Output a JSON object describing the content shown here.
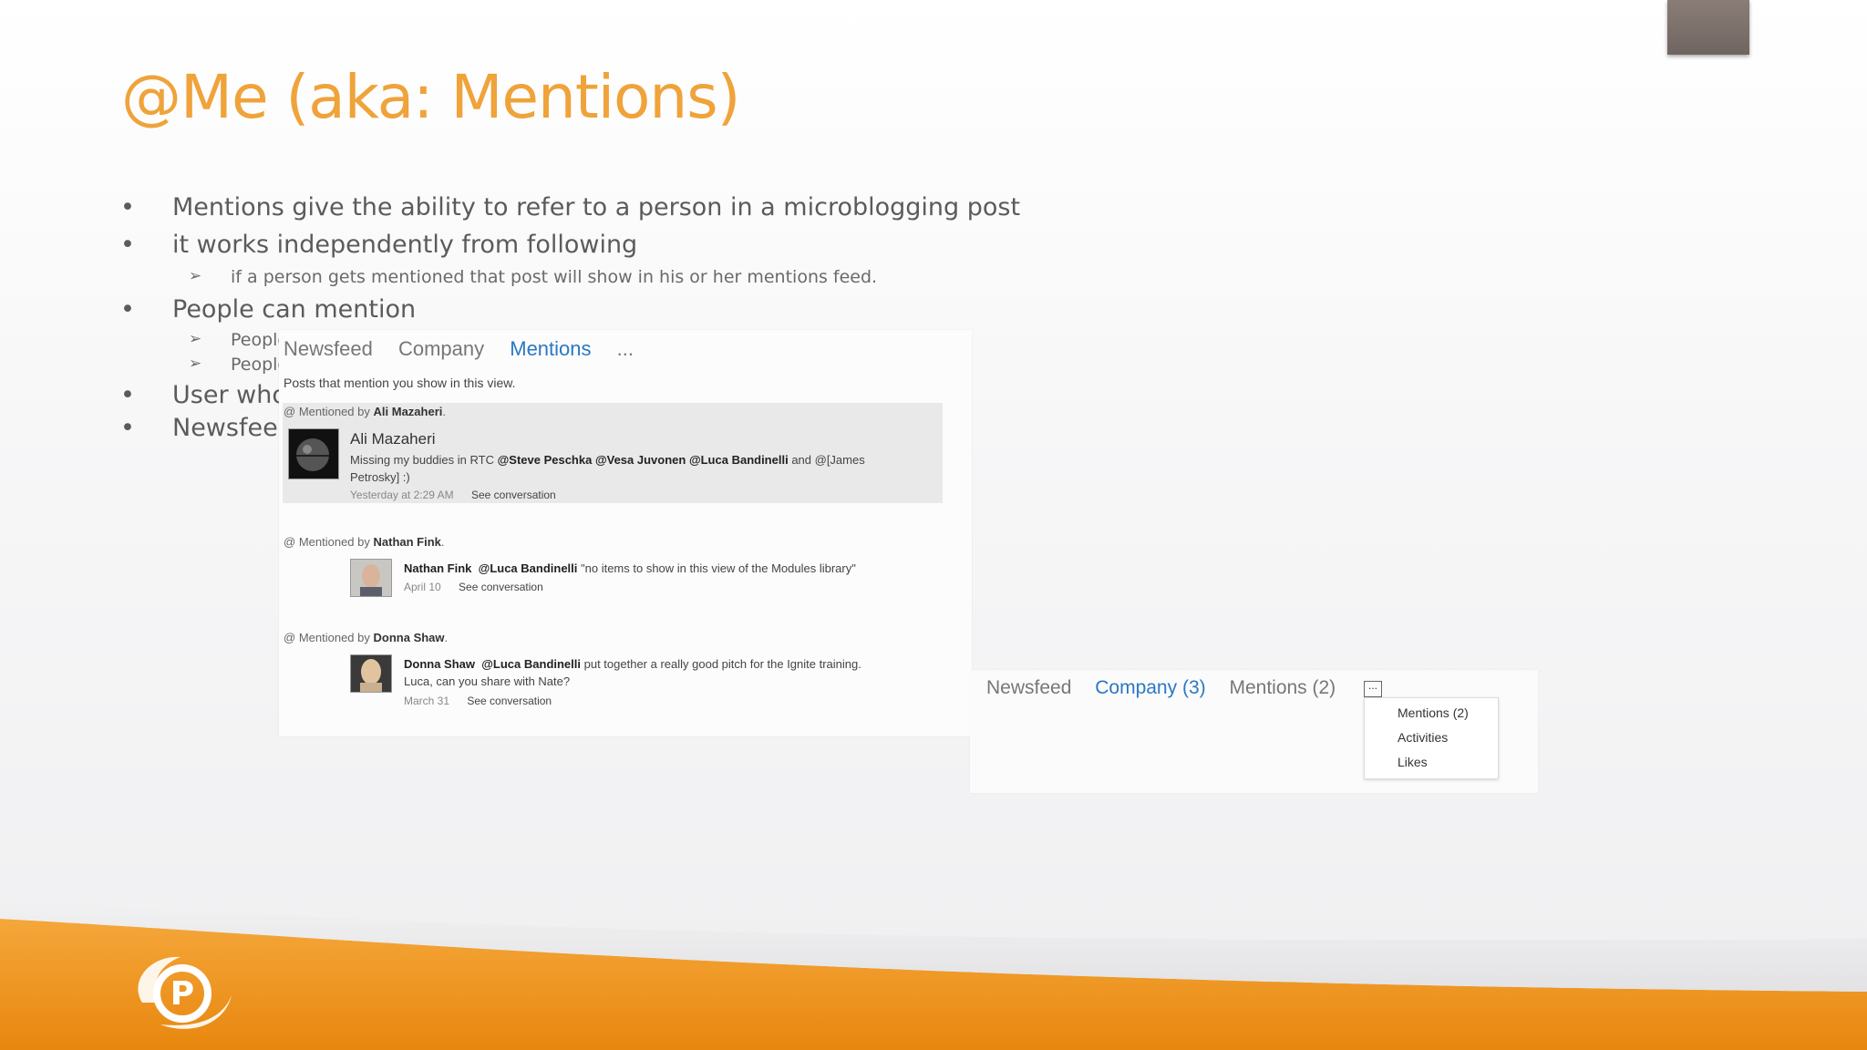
{
  "slide": {
    "title": "@Me (aka: Mentions)",
    "bullets": [
      "Mentions give the ability to refer to a person in a microblogging post",
      "it works independently from following",
      "People can mention",
      "User who g",
      "Newsfeed p"
    ],
    "subbullets": [
      "if a person gets mentioned that post will show in his or her mentions feed.",
      "People",
      "People"
    ],
    "bullet_glyph": "•",
    "sub_glyph": "➢"
  },
  "mentions_panel": {
    "tabs": [
      "Newsfeed",
      "Company",
      "Mentions",
      "..."
    ],
    "hint": "Posts that mention you show in this view.",
    "posts": [
      {
        "mentioned_prefix": "Mentioned by",
        "mentioned_by": "Ali Mazaheri",
        "author": "Ali Mazaheri",
        "text_prefix": "Missing my buddies in RTC ",
        "mentions": "@Steve Peschka @Vesa Juvonen @Luca Bandinelli",
        "text_suffix": " and @[James Petrosky] :)",
        "time": "Yesterday at 2:29 AM",
        "link": "See conversation"
      },
      {
        "mentioned_prefix": "Mentioned by",
        "mentioned_by": "Nathan Fink",
        "author": "Nathan Fink",
        "mentions": "@Luca Bandinelli",
        "text_suffix": " \"no items to show in this view of the Modules library\"",
        "time": "April 10",
        "link": "See conversation"
      },
      {
        "mentioned_prefix": "Mentioned by",
        "mentioned_by": "Donna Shaw",
        "author": "Donna Shaw",
        "mentions": "@Luca Bandinelli",
        "text_suffix": " put together a really good pitch for the Ignite training.",
        "text_line2": "Luca, can you share with Nate?",
        "time": "March 31",
        "link": "See conversation"
      }
    ]
  },
  "company_panel": {
    "tabs": [
      "Newsfeed",
      "Company (3)",
      "Mentions (2)"
    ],
    "more": "...",
    "menu": [
      "Mentions (2)",
      "Activities",
      "Likes"
    ]
  },
  "colors": {
    "accent": "#efa33a",
    "link": "#2a78c2",
    "footer_orange": "#f09a1e"
  }
}
